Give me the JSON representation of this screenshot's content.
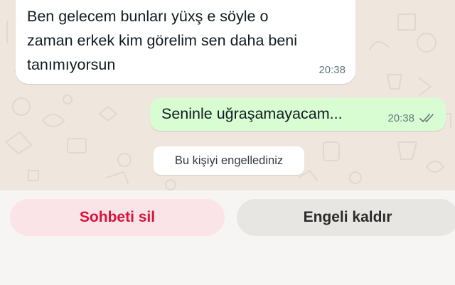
{
  "conversation": {
    "incoming_message": {
      "text": "Ben gelecem bunları yüxş e söyle o\nzaman erkek kim görelim sen daha beni\ntanımıyorsun",
      "time": "20:38"
    },
    "outgoing_message": {
      "text": "Seninle uğraşamayacam...",
      "time": "20:38",
      "status_icon": "double-check-icon"
    },
    "system_notice": "Bu kişiyi engellediniz"
  },
  "actions": {
    "delete_chat_label": "Sohbeti sil",
    "unblock_label": "Engeli kaldır"
  },
  "colors": {
    "wallpaper": "#efe7de",
    "incoming_bubble": "#ffffff",
    "outgoing_bubble": "#d9fdd3",
    "delete_text": "#d8133c",
    "delete_bg": "#fbe4e7",
    "unblock_bg": "#e8e6e3"
  }
}
